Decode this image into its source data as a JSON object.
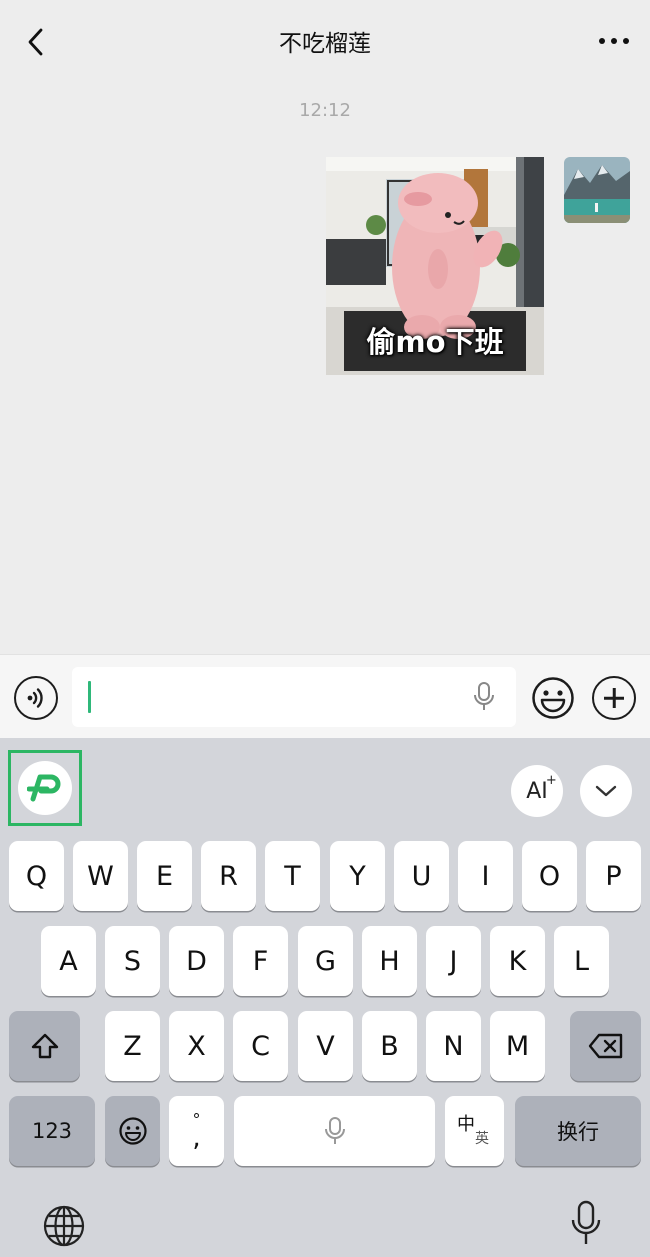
{
  "header": {
    "title": "不吃榴莲",
    "back_icon": "chevron-left-icon",
    "more_icon": "more-dots-icon"
  },
  "chat": {
    "timestamp": "12:12",
    "sticker_caption": "偷mo下班"
  },
  "input_bar": {
    "input_value": "",
    "voice_icon": "voice-icon",
    "emoji_icon": "emoji-icon",
    "plus_icon": "plus-icon"
  },
  "keyboard": {
    "rows": [
      [
        "Q",
        "W",
        "E",
        "R",
        "T",
        "Y",
        "U",
        "I",
        "O",
        "P"
      ],
      [
        "A",
        "S",
        "D",
        "F",
        "G",
        "H",
        "J",
        "K",
        "L"
      ],
      [
        "Z",
        "X",
        "C",
        "V",
        "B",
        "N",
        "M"
      ]
    ],
    "key_123": "123",
    "key_punct_top": "°",
    "key_punct_bottom": ",",
    "key_lang_zh": "中",
    "key_lang_en": "英",
    "key_return": "换行",
    "key_ai": "AI",
    "accent_color": "#2cb663",
    "caret_color": "#2fb87a"
  }
}
